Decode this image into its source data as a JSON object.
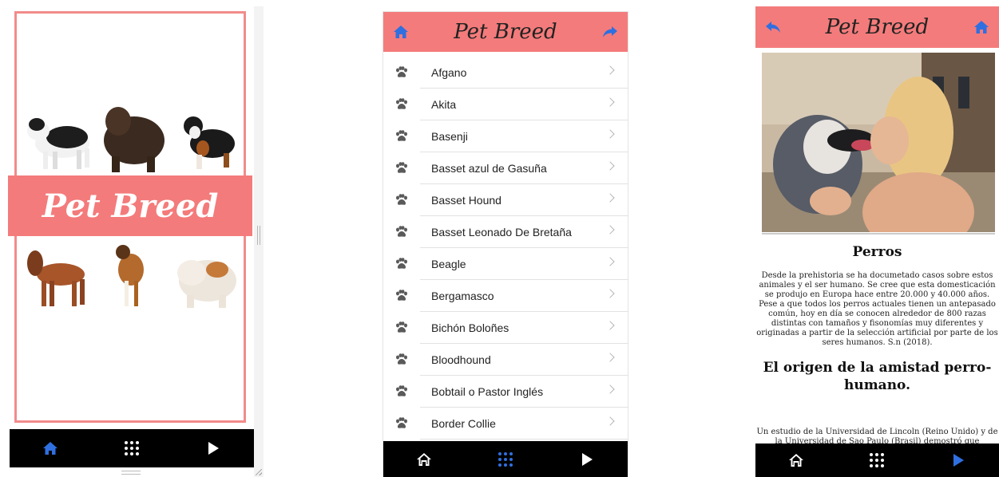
{
  "splash": {
    "brand": "Pet Breed"
  },
  "list_screen": {
    "title": "Pet Breed",
    "breeds": [
      "Afgano",
      "Akita",
      "Basenji",
      "Basset azul de Gasuña",
      "Basset Hound",
      "Basset Leonado De Bretaña",
      "Beagle",
      "Bergamasco",
      "Bichón Boloñes",
      "Bloodhound",
      "Bobtail o Pastor Inglés",
      "Border Collie"
    ]
  },
  "detail_screen": {
    "title": "Pet Breed",
    "heading": "Perros",
    "paragraph": "Desde la prehistoria se ha documetado casos sobre estos animales y el ser humano. Se cree que esta domesticación se produjo en Europa hace entre 20.000 y 40.000 años. Pese a que todos los perros actuales tienen un antepasado común, hoy en día se conocen alrededor de 800 razas distintas con tamaños y fisonomías muy diferentes y originadas a partir de la selección artificial por parte de los seres humanos. S.n (2018).",
    "subheading": "El origen de la amistad perro-humano.",
    "paragraph2": "Un estudio de la Universidad de Lincoln (Reino Unido) y de la Universidad de Sao Paulo (Brasil) demostró que"
  },
  "icons": {
    "home": "home-icon",
    "grid": "grid-icon",
    "play": "play-icon",
    "share": "share-icon",
    "back": "back-icon",
    "paw": "paw-icon",
    "chevron": "chevron-right-icon"
  },
  "colors": {
    "brand": "#f47b7b",
    "active_tab": "#2f6fe0",
    "tabbar": "#000000"
  }
}
